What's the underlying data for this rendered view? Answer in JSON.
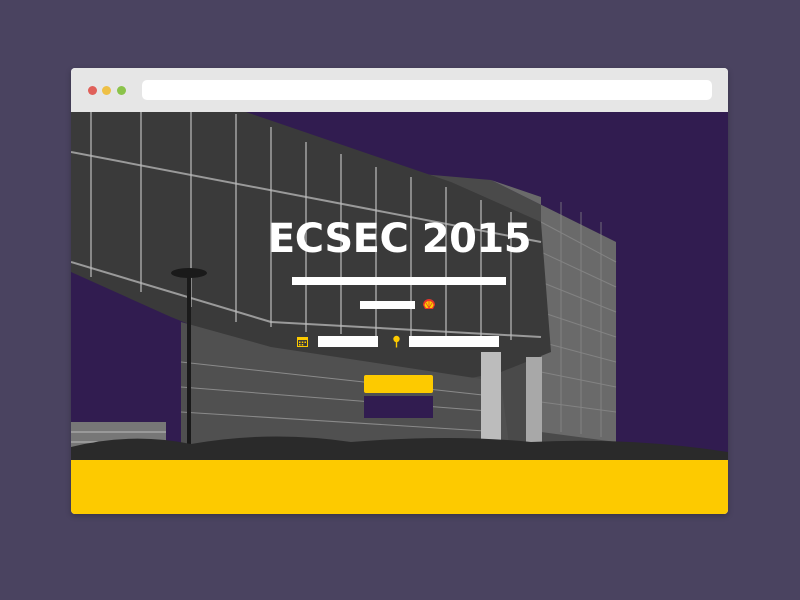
{
  "browser": {
    "address": ""
  },
  "hero": {
    "title": "ECSEC 2015"
  },
  "colors": {
    "background": "#4a4360",
    "hero_purple": "#311c50",
    "accent_yellow": "#fdca00",
    "chrome_gray": "#e6e6e6"
  },
  "icons": {
    "brand": "shell-logo-icon",
    "date": "calendar-icon",
    "location": "location-pin-icon"
  }
}
